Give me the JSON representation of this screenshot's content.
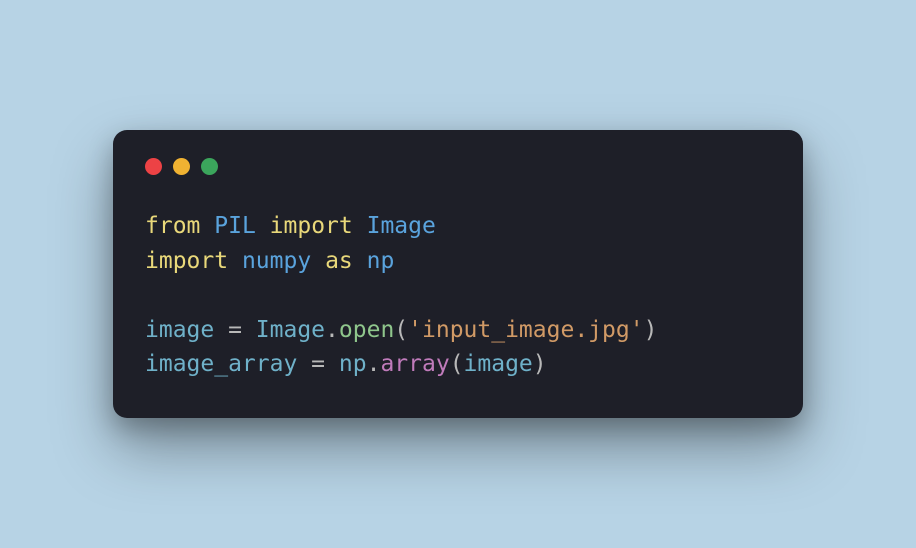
{
  "code": {
    "line1": {
      "kw_from": "from",
      "mod_pil": "PIL",
      "kw_import": "import",
      "mod_image": "Image"
    },
    "line2": {
      "kw_import": "import",
      "mod_numpy": "numpy",
      "kw_as": "as",
      "mod_np": "np"
    },
    "line4": {
      "var_image": "image",
      "eq": " = ",
      "cls_image": "Image",
      "dot": ".",
      "fn_open": "open",
      "lparen": "(",
      "str_arg": "'input_image.jpg'",
      "rparen": ")"
    },
    "line5": {
      "var_arr": "image_array",
      "eq": " = ",
      "mod_np": "np",
      "dot": ".",
      "fn_array": "array",
      "lparen": "(",
      "arg_image": "image",
      "rparen": ")"
    }
  }
}
